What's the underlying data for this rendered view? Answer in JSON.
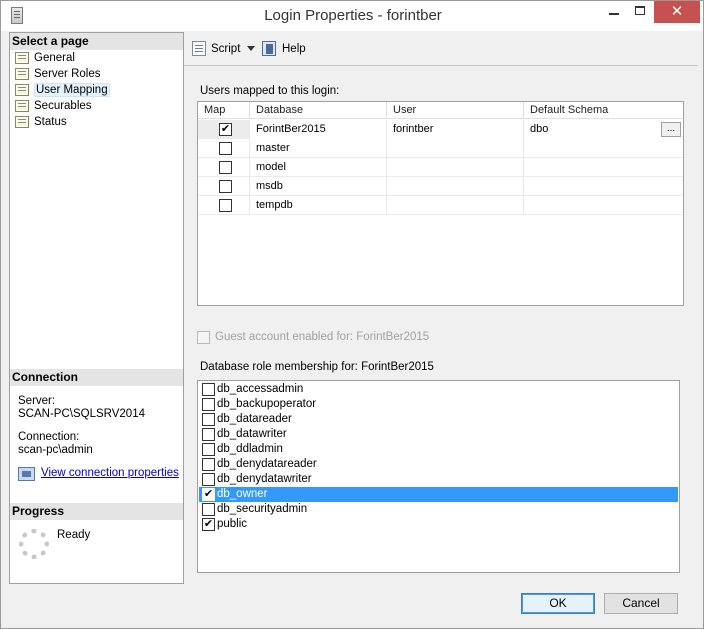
{
  "window": {
    "title": "Login Properties - forintber",
    "minimize": "",
    "maximize": "",
    "close": "✕"
  },
  "left_panel": {
    "select_page_header": "Select a page",
    "pages": [
      {
        "label": "General"
      },
      {
        "label": "Server Roles"
      },
      {
        "label": "User Mapping"
      },
      {
        "label": "Securables"
      },
      {
        "label": "Status"
      }
    ],
    "selected_page": "User Mapping",
    "connection_header": "Connection",
    "server_label": "Server:",
    "server_value": "SCAN-PC\\SQLSRV2014",
    "connection_label": "Connection:",
    "connection_value": "scan-pc\\admin",
    "view_connection_link": "View connection properties",
    "progress_header": "Progress",
    "progress_status": "Ready"
  },
  "toolbar": {
    "script_label": "Script",
    "help_label": "Help"
  },
  "user_mapping": {
    "mapped_label": "Users mapped to this login:",
    "columns": [
      "Map",
      "Database",
      "User",
      "Default Schema"
    ],
    "rows": [
      {
        "map": true,
        "database": "ForintBer2015",
        "user": "forintber",
        "schema": "dbo"
      },
      {
        "map": false,
        "database": "master",
        "user": "",
        "schema": ""
      },
      {
        "map": false,
        "database": "model",
        "user": "",
        "schema": ""
      },
      {
        "map": false,
        "database": "msdb",
        "user": "",
        "schema": ""
      },
      {
        "map": false,
        "database": "tempdb",
        "user": "",
        "schema": ""
      }
    ],
    "ellipsis": "...",
    "guest_label": "Guest account enabled for: ForintBer2015",
    "role_label": "Database role membership for: ForintBer2015",
    "roles": [
      {
        "name": "db_accessadmin",
        "checked": false
      },
      {
        "name": "db_backupoperator",
        "checked": false
      },
      {
        "name": "db_datareader",
        "checked": false
      },
      {
        "name": "db_datawriter",
        "checked": false
      },
      {
        "name": "db_ddladmin",
        "checked": false
      },
      {
        "name": "db_denydatareader",
        "checked": false
      },
      {
        "name": "db_denydatawriter",
        "checked": false
      },
      {
        "name": "db_owner",
        "checked": true
      },
      {
        "name": "db_securityadmin",
        "checked": false
      },
      {
        "name": "public",
        "checked": true
      }
    ],
    "highlighted_role": "db_owner"
  },
  "footer": {
    "ok_label": "OK",
    "cancel_label": "Cancel"
  },
  "check_glyph": "✔"
}
